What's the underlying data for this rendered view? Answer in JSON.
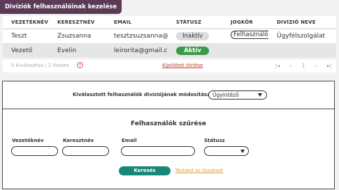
{
  "page_title": "Divíziók felhasználóinak kezelése",
  "table": {
    "headers": [
      "VEZETÉKNÉV",
      "KERESZTNÉV",
      "EMAIL",
      "STÁTUSZ",
      "JOGKÖR",
      "DIVÍZIÓ NEVE"
    ],
    "rows": [
      {
        "last_name": "Teszt",
        "first_name": "Zsuzsanna",
        "email": "tesztzsuzsanna@gmail.com",
        "status": "Inaktív",
        "role": "Felhasználó",
        "division": "Ügyfélszolgálat"
      },
      {
        "last_name": "Vezető",
        "first_name": "Evelin",
        "email": "leirorita@gmail.com",
        "status": "Aktív",
        "role": "",
        "division": ""
      }
    ]
  },
  "footer": {
    "selection_count": "0 kiválasztva / 2 összes",
    "info_icon_text": "!",
    "clear_selection": "Kijelöltek törlése",
    "pager": {
      "first": "|◂",
      "prev": "‹",
      "page": "1",
      "next": "›",
      "last": "▸|"
    }
  },
  "division_change": {
    "label": "Kiválasztott felhasználók divíziójának módosítása:",
    "selected": "Ügyintéző"
  },
  "filter": {
    "title": "Felhasználók szűrése",
    "last_name_label": "Vezetéknév",
    "first_name_label": "Keresztnév",
    "email_label": "Email",
    "status_label": "Státusz",
    "search_button": "Keresés",
    "show_all": "Mutasd az összeset"
  },
  "colors": {
    "title_bg": "#5b3a57",
    "active_status": "#3a9a4a",
    "search_button": "#17877a",
    "clear_link": "#c0392b",
    "show_all_link": "#e09a2b"
  },
  "icons": {
    "dropdown": "chevron-down-icon",
    "info": "info-icon"
  }
}
